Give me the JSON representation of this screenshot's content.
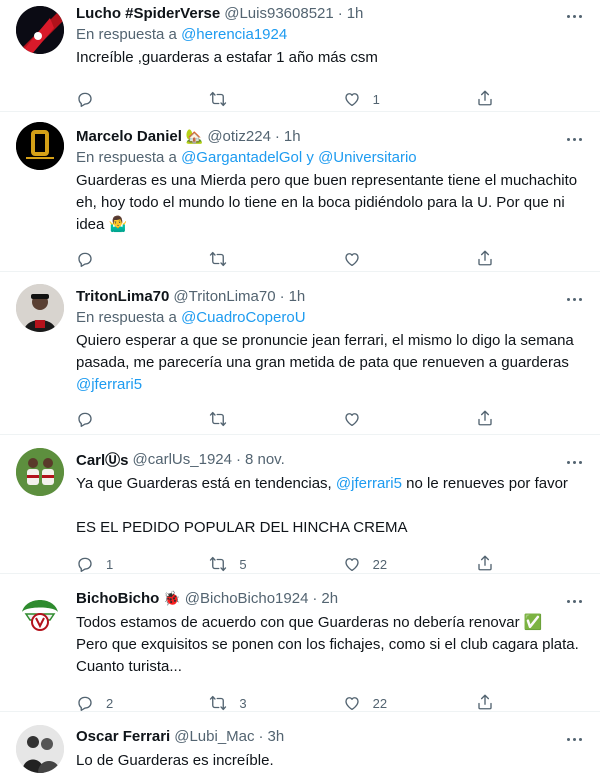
{
  "tweets": [
    {
      "name": "Lucho #SpiderVerse",
      "name_emoji": "",
      "handle": "@Luis93608521",
      "time": "1h",
      "reply_prefix": "En respuesta a",
      "reply_to": [
        "@herencia1924"
      ],
      "reply_joiner": "",
      "text_lines": [
        "Increíble ,guarderas a estafar 1 año más csm"
      ],
      "text_mention": "",
      "counts": {
        "reply": "",
        "retweet": "",
        "like": "1"
      }
    },
    {
      "name": "Marcelo Daniel",
      "name_emoji": "🏡",
      "handle": "@otiz224",
      "time": "1h",
      "reply_prefix": "En respuesta a",
      "reply_to": [
        "@GargantadelGol",
        "@Universitario"
      ],
      "reply_joiner": "y",
      "text_lines": [
        "Guarderas es una Mierda pero que buen representante tiene el muchachito",
        "eh, hoy todo el mundo lo tiene en la boca pidiéndolo para la U. Por que ni",
        "idea 🤷‍♂️"
      ],
      "text_mention": "",
      "counts": {
        "reply": "",
        "retweet": "",
        "like": ""
      }
    },
    {
      "name": "TritonLima70",
      "name_emoji": "",
      "handle": "@TritonLima70",
      "time": "1h",
      "reply_prefix": "En respuesta a",
      "reply_to": [
        "@CuadroCoperoU"
      ],
      "reply_joiner": "",
      "text_lines": [
        "Quiero esperar a que se pronuncie jean ferrari, el mismo lo digo la semana",
        "pasada, me parecería una gran metida de pata que renueven a guarderas"
      ],
      "text_mention": "@jferrari5",
      "counts": {
        "reply": "",
        "retweet": "",
        "like": ""
      }
    },
    {
      "name": "CarlⓊs",
      "name_emoji": "",
      "handle": "@carlUs_1924",
      "time": "8 nov.",
      "reply_prefix": "",
      "reply_to": [],
      "reply_joiner": "",
      "text_line1_before": "Ya que Guarderas está en tendencias,",
      "text_line1_mention": "@jferrari5",
      "text_line1_after": "no le renueves por favor",
      "text_line2": "ES EL PEDIDO POPULAR DEL HINCHA CREMA",
      "counts": {
        "reply": "1",
        "retweet": "5",
        "like": "22"
      }
    },
    {
      "name": "BichoBicho",
      "name_emoji": "🐞",
      "handle": "@BichoBicho1924",
      "time": "2h",
      "reply_prefix": "",
      "reply_to": [],
      "reply_joiner": "",
      "text_lines": [
        "Todos estamos de acuerdo con que Guarderas no debería renovar ✅",
        "Pero que exquisitos se ponen con los fichajes, como si el club cagara plata.",
        "Cuanto turista..."
      ],
      "text_mention": "",
      "counts": {
        "reply": "2",
        "retweet": "3",
        "like": "22"
      }
    },
    {
      "name": "Oscar Ferrari",
      "name_emoji": "",
      "handle": "@Lubi_Mac",
      "time": "3h",
      "reply_prefix": "",
      "reply_to": [],
      "reply_joiner": "",
      "text_lines": [
        "Lo de Guarderas es increíble."
      ],
      "text_mention": "",
      "counts": {
        "reply": "",
        "retweet": "",
        "like": ""
      }
    }
  ],
  "icons": [
    "reply-icon",
    "retweet-icon",
    "like-icon",
    "share-icon",
    "more-icon"
  ],
  "colors": {
    "link": "#1d9bf0",
    "muted": "#536471",
    "text": "#0f1419",
    "divider": "#eff3f4"
  }
}
